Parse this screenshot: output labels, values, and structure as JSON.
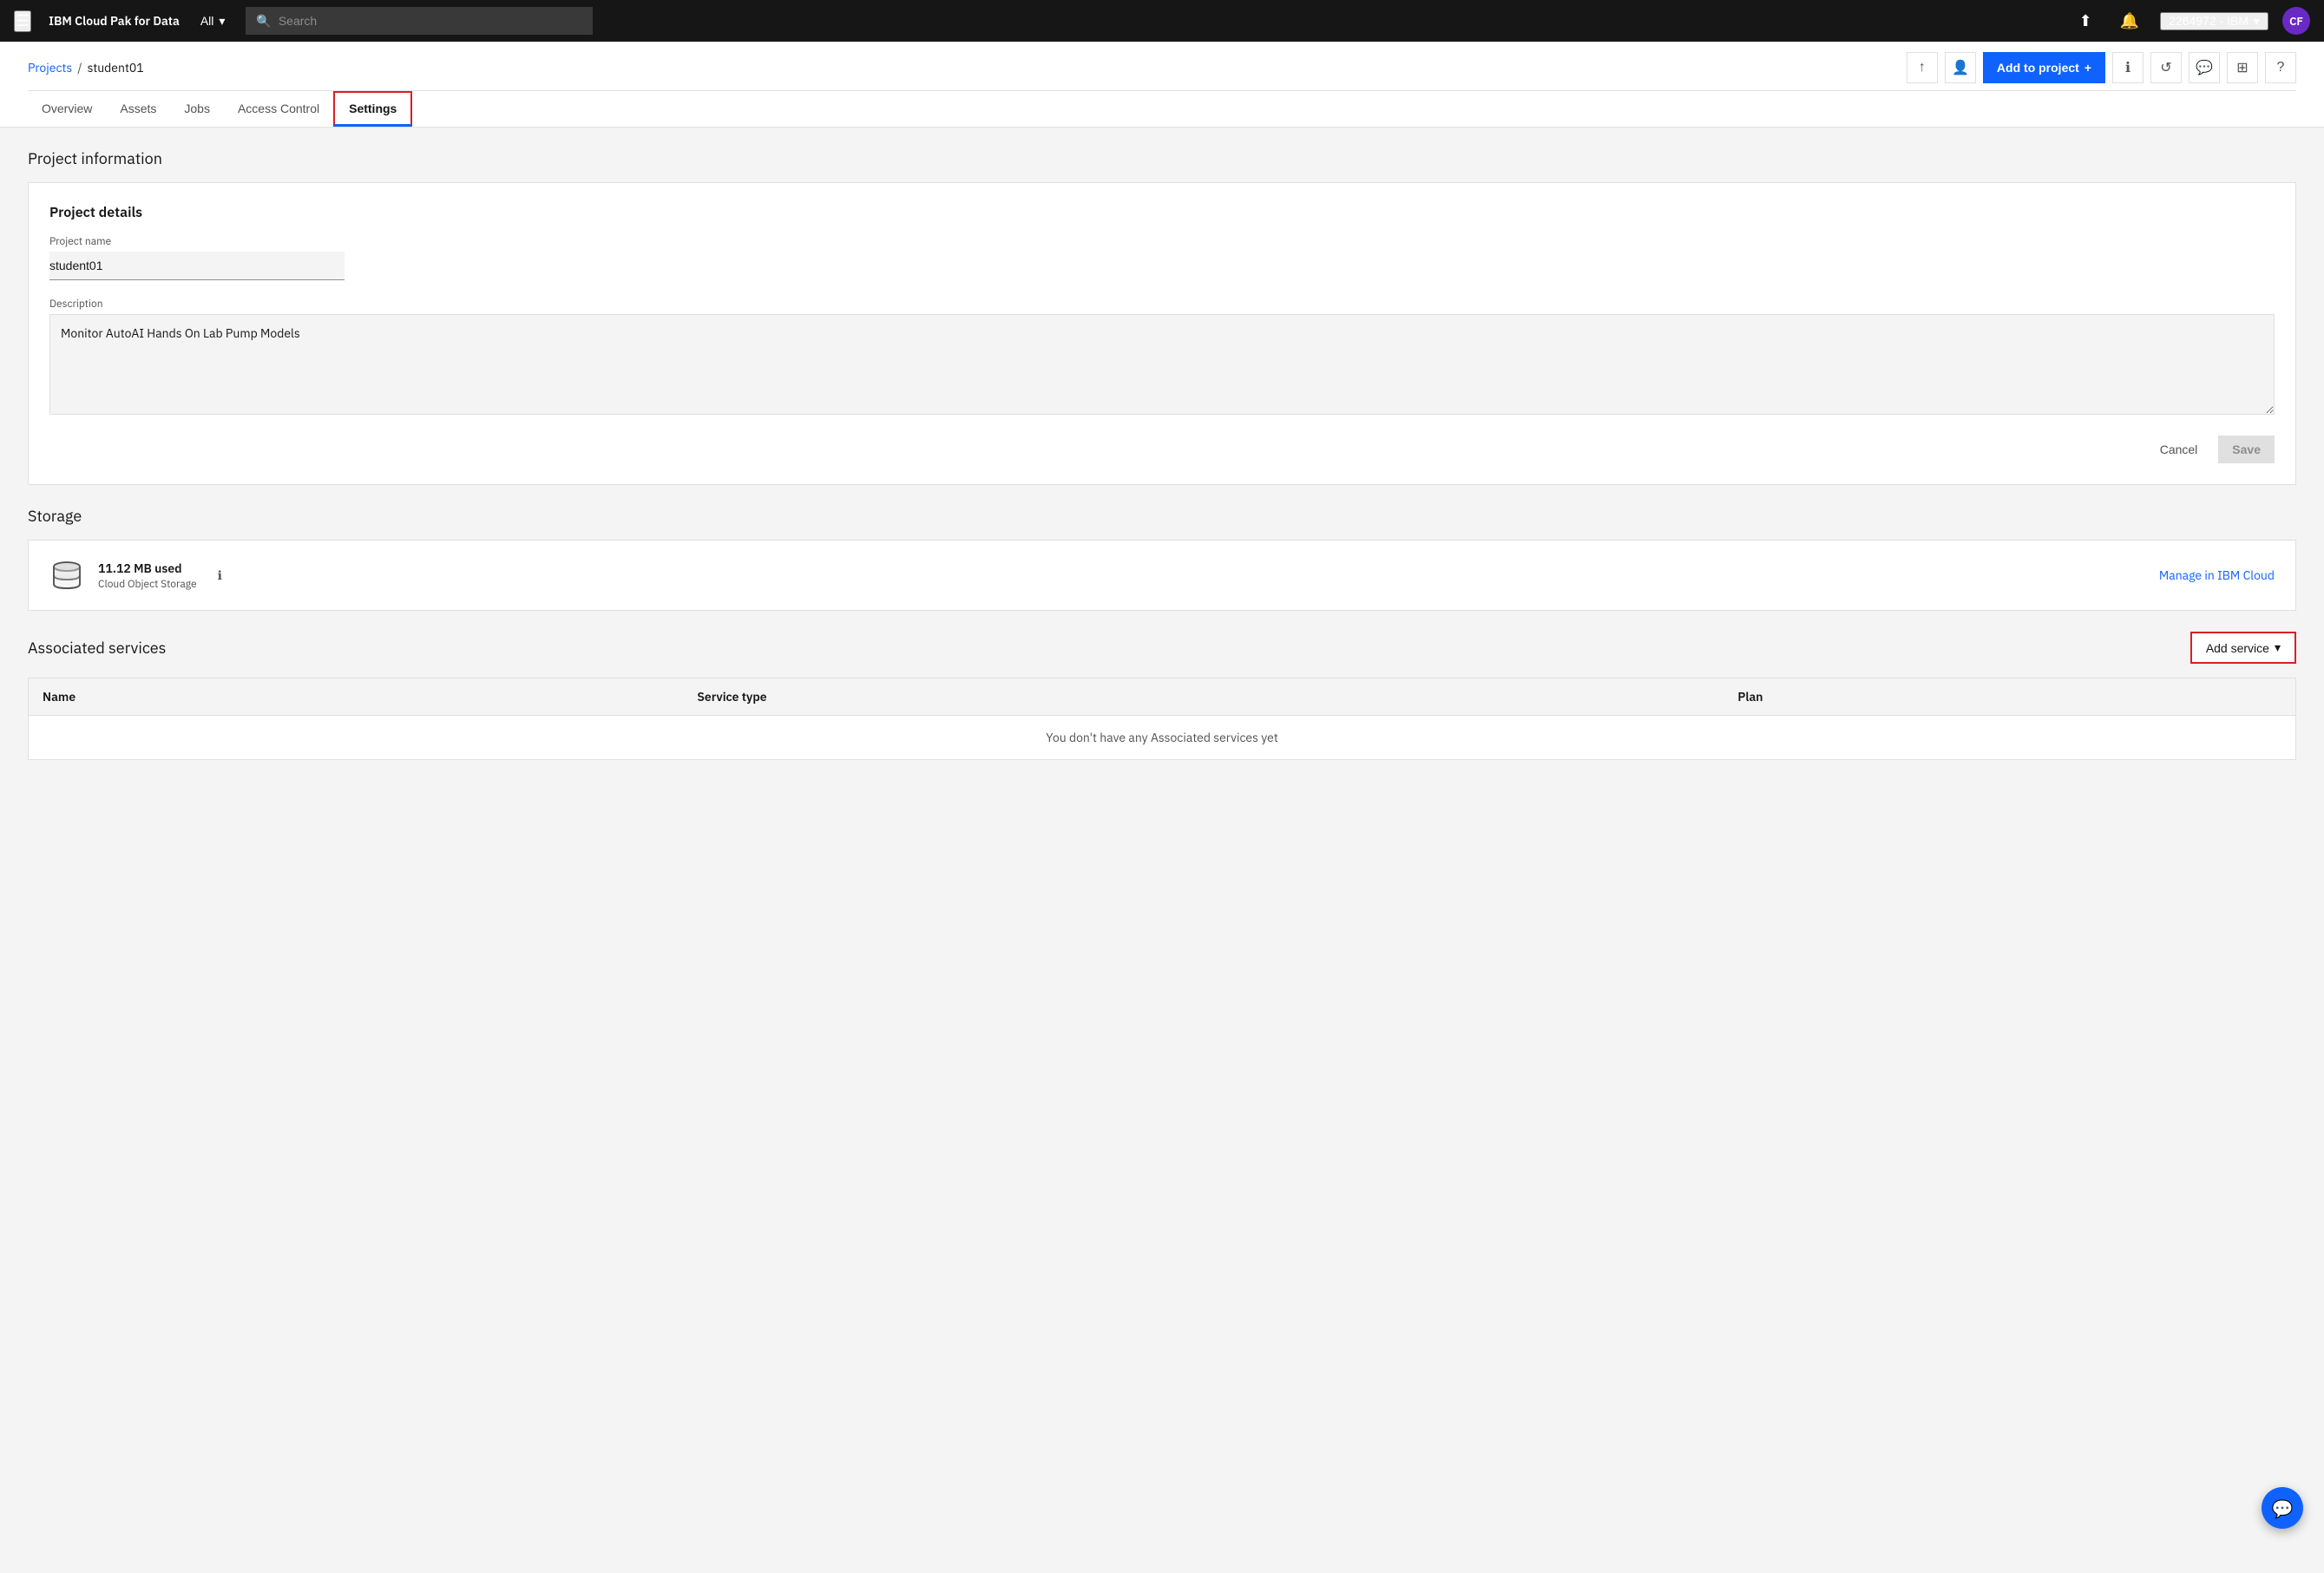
{
  "topnav": {
    "menu_icon": "☰",
    "brand": "IBM Cloud Pak for Data",
    "dropdown_label": "All",
    "search_placeholder": "Search",
    "user_label": "2264972 - IBM",
    "avatar_initials": "CF"
  },
  "breadcrumb": {
    "projects_label": "Projects",
    "separator": "/",
    "current": "student01"
  },
  "header_actions": {
    "upload_icon": "↑",
    "add_collaborator_icon": "👤+",
    "add_to_project_label": "Add to project",
    "plus_icon": "+",
    "info_icon": "ℹ",
    "history_icon": "↺",
    "chat_icon": "💬",
    "grid_icon": "⊞",
    "help_icon": "?"
  },
  "tabs": [
    {
      "id": "overview",
      "label": "Overview"
    },
    {
      "id": "assets",
      "label": "Assets"
    },
    {
      "id": "jobs",
      "label": "Jobs"
    },
    {
      "id": "access-control",
      "label": "Access Control"
    },
    {
      "id": "settings",
      "label": "Settings",
      "active": true
    }
  ],
  "project_info": {
    "section_title": "Project information",
    "card_title": "Project details",
    "name_label": "Project name",
    "name_value": "student01",
    "description_label": "Description",
    "description_value": "Monitor AutoAI Hands On Lab Pump Models",
    "cancel_label": "Cancel",
    "save_label": "Save"
  },
  "storage": {
    "section_title": "Storage",
    "size": "11.12 MB used",
    "type": "Cloud Object Storage",
    "manage_link": "Manage in IBM Cloud"
  },
  "associated_services": {
    "section_title": "Associated services",
    "add_service_label": "Add service",
    "dropdown_icon": "▾",
    "table_headers": [
      "Name",
      "Service type",
      "Plan"
    ],
    "empty_message": "You don't have any Associated services yet"
  },
  "chat_fab_icon": "💬"
}
